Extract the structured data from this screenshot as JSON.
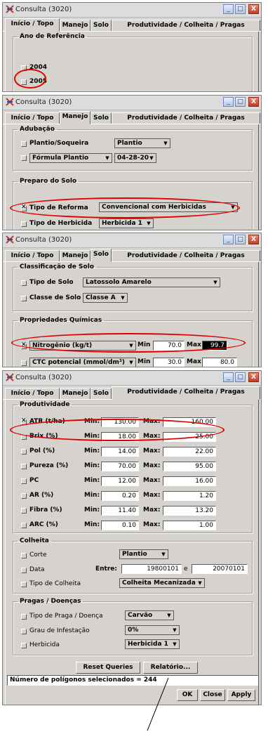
{
  "window_title": "Consulta (3020)",
  "window_buttons": {
    "min": "_",
    "max": "□",
    "close": "X"
  },
  "tabs": [
    "Início / Topo",
    "Manejo",
    "Solo",
    "Produtividade / Colheita / Pragas"
  ],
  "panel1": {
    "group_title": "Ano de Referência",
    "years": [
      {
        "label": "2004",
        "checked": false
      },
      {
        "label": "2005",
        "checked": false
      }
    ]
  },
  "panel2": {
    "adubacao": {
      "title": "Adubação",
      "plantio_label": "Plantio/Soqueira",
      "plantio_value": "Plantio",
      "formula_value": "Fórmula Plantio",
      "formula_npk": "04-28-20"
    },
    "preparo": {
      "title": "Preparo do Solo",
      "reforma_label": "Tipo de Reforma",
      "reforma_value": "Convencional com Herbicidas",
      "herbicida_label": "Tipo de Herbicida",
      "herbicida_value": "Herbicida 1"
    }
  },
  "panel3": {
    "classificacao": {
      "title": "Classificação de Solo",
      "tipo_label": "Tipo de Solo",
      "tipo_value": "Latossolo Amarelo",
      "classe_label": "Classe de Solo",
      "classe_value": "Classe A"
    },
    "quimicas": {
      "title": "Propriedades Químicas",
      "row1": {
        "property": "Nitrogênio (kg/t)",
        "min_label": "Min",
        "min": "70.0",
        "max_label": "Max",
        "max": "99.7"
      },
      "row2": {
        "property": "CTC potencial (mmol/dm³)",
        "min_label": "Min",
        "min": "30.0",
        "max_label": "Max",
        "max": "80.0"
      }
    }
  },
  "panel4": {
    "produtividade": {
      "title": "Produtividade",
      "min_label": "Min:",
      "max_label": "Max:",
      "rows": [
        {
          "label": "ATR (t/ha)",
          "min": "130.00",
          "max": "160.00"
        },
        {
          "label": "Brix (%)",
          "min": "18.00",
          "max": "25.00"
        },
        {
          "label": "Pol (%)",
          "min": "14.00",
          "max": "22.00"
        },
        {
          "label": "Pureza (%)",
          "min": "70.00",
          "max": "95.00"
        },
        {
          "label": "PC",
          "min": "12.00",
          "max": "16.00"
        },
        {
          "label": "AR (%)",
          "min": "0.20",
          "max": "1.20"
        },
        {
          "label": "Fibra (%)",
          "min": "11.40",
          "max": "13.20"
        },
        {
          "label": "ARC (%)",
          "min": "0.10",
          "max": "1.00"
        }
      ]
    },
    "colheita": {
      "title": "Colheita",
      "corte_label": "Corte",
      "corte_value": "Plantio",
      "data_label": "Data",
      "entre_label": "Entre:",
      "data_from": "19800101",
      "e_label": "e",
      "data_to": "20070101",
      "tipo_label": "Tipo de Colheita",
      "tipo_value": "Colheita Mecanizada"
    },
    "pragas": {
      "title": "Pragas / Doenças",
      "praga_label": "Tipo de Praga / Doença",
      "praga_value": "Carvão",
      "grau_label": "Grau de Infestação",
      "grau_value": "0%",
      "herb_label": "Herbicida",
      "herb_value": "Herbicida 1"
    },
    "reset_label": "Reset Queries",
    "relatorio_label": "Relatório...",
    "status_text": "Número de polígonos selecionados = 244",
    "ok_label": "OK",
    "close_label": "Close",
    "apply_label": "Apply"
  },
  "colors": {
    "highlight_oval": "#e00000",
    "window_bg": "#d6d3ce",
    "close_button": "#c23b22"
  }
}
